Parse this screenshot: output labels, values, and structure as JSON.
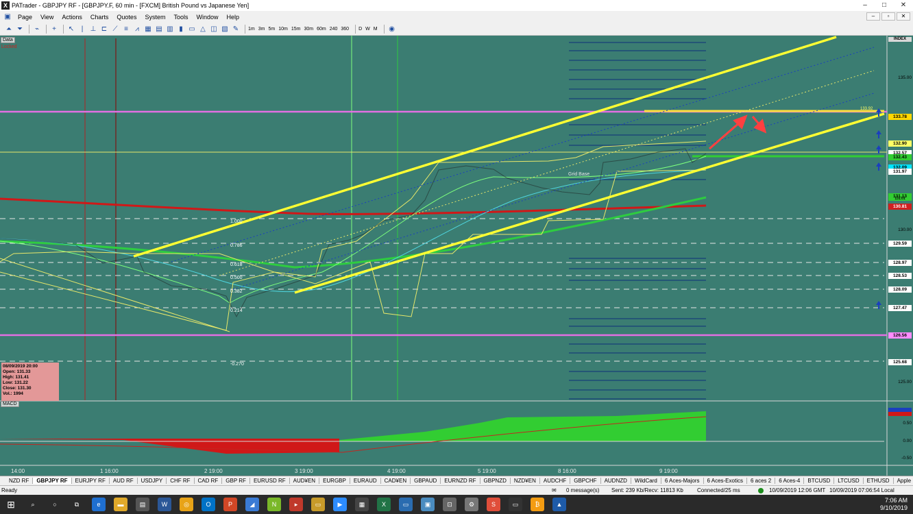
{
  "window": {
    "title": "PATrader - GBPJPY RF - [GBPJPY.F, 60 min - [FXCM] British Pound vs Japanese Yen]",
    "app_icon": "X",
    "controls": [
      "–",
      "□",
      "✕"
    ]
  },
  "menu": [
    "Page",
    "View",
    "Actions",
    "Charts",
    "Quotes",
    "System",
    "Tools",
    "Window",
    "Help"
  ],
  "mdi_controls": [
    "–",
    "▫",
    "✕"
  ],
  "toolbar": {
    "timeframes": [
      "1m",
      "3m",
      "5m",
      "10m",
      "15m",
      "30m",
      "60m",
      "240",
      "360",
      "D",
      "W",
      "M"
    ]
  },
  "chart": {
    "data_label": "Data",
    "locked_label": "Locked",
    "index_label": "INDEX",
    "grid_base_label": "Grid Base",
    "fib_levels": [
      "1.000",
      "0.786",
      "0.618",
      "0.500",
      "0.382",
      "0.214",
      "-0.270"
    ],
    "ohlc": {
      "date": "08/09/2019 20:00",
      "open": "Open: 131.33",
      "high": "High: 131.41",
      "low": "Low: 131.22",
      "close": "Close: 131.30",
      "vol": "Vol.: 1994"
    },
    "price_ticks": [
      "135.00",
      "130.00",
      "125.00"
    ],
    "price_badges": [
      {
        "text": "133.78",
        "color": "#ffd700"
      },
      {
        "text": "132.90",
        "color": "#ffff66"
      },
      {
        "text": "132.57",
        "color": "#ffffff"
      },
      {
        "text": "132.43",
        "color": "#32cd32"
      },
      {
        "text": "132.09",
        "color": "#00e5ff"
      },
      {
        "text": "131.97",
        "color": "#ffffff"
      },
      {
        "text": "131.13",
        "color": "#32cd32"
      },
      {
        "text": "131.01",
        "color": "#32cd32"
      },
      {
        "text": "130.81",
        "color": "#d02020"
      },
      {
        "text": "129.59",
        "color": "#ffffff"
      },
      {
        "text": "128.97",
        "color": "#ffffff"
      },
      {
        "text": "128.53",
        "color": "#ffffff"
      },
      {
        "text": "128.09",
        "color": "#ffffff"
      },
      {
        "text": "127.47",
        "color": "#ffffff"
      },
      {
        "text": "126.56",
        "color": "#ff8cff"
      },
      {
        "text": "125.68",
        "color": "#ffffff"
      }
    ],
    "small_label": "133.92",
    "macd_label": "MACD",
    "macd_ticks": [
      "0.50",
      "0.00",
      "-0.50"
    ],
    "x_labels": [
      "14:00",
      "1 16:00",
      "2 19:00",
      "3 19:00",
      "4 19:00",
      "5 19:00",
      "8 16:00",
      "9 19:00"
    ]
  },
  "tabs": [
    "NZD RF",
    "GBPJPY RF",
    "EURJPY RF",
    "AUD RF",
    "USDJPY",
    "CHF RF",
    "CAD RF",
    "GBP RF",
    "EURUSD RF",
    "AUD¥EN",
    "EURGBP",
    "EURAUD",
    "CAD¥EN",
    "GBPAUD",
    "EURNZD RF",
    "GBPNZD",
    "NZD¥EN",
    "AUDCHF",
    "GBPCHF",
    "AUDNZD",
    "WildCard",
    "6 Aces-Majors",
    "6 Aces-Exotics",
    "6 aces 2",
    "6 Aces-4",
    "BTCUSD",
    "LTCUSD",
    "ETHUSD",
    "Apple"
  ],
  "active_tab": "GBPJPY RF",
  "status": {
    "ready": "Ready",
    "messages": "0 message(s)",
    "traffic": "Sent: 239 Kb/Recv: 11813 Kb",
    "connection": "Connected/25 ms",
    "time_gmt": "10/09/2019 12:06 GMT",
    "time_local": "10/09/2019 07:06:54 Local"
  },
  "taskbar": {
    "time": "7:06 AM",
    "date": "9/10/2019"
  }
}
